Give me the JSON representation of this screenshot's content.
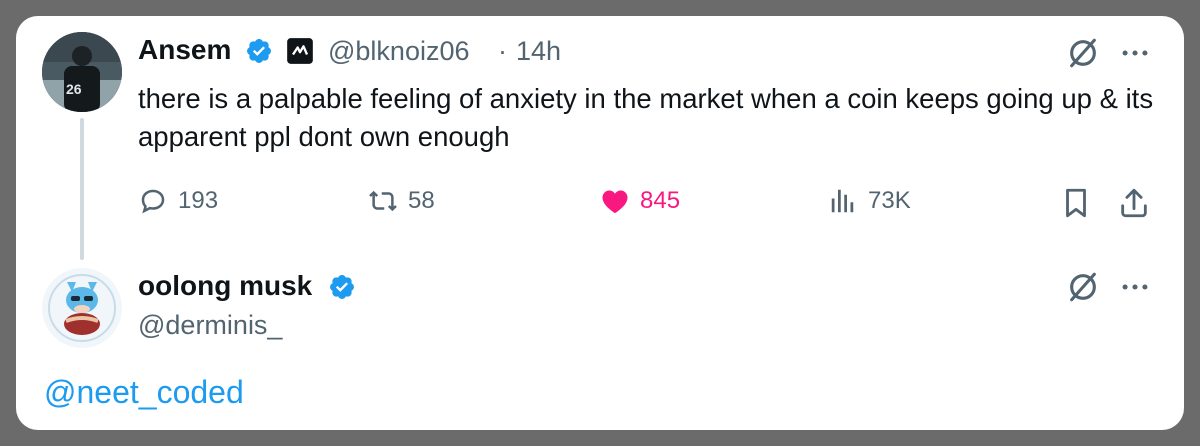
{
  "post": {
    "author_name": "Ansem",
    "author_handle": "@blknoiz06",
    "separator": "·",
    "time": "14h",
    "text": "there is a palpable feeling of anxiety in the market when a coin keeps going up & its apparent ppl dont own enough",
    "avatar_jersey": "26",
    "stats": {
      "replies": "193",
      "reposts": "58",
      "likes": "845",
      "views": "73K"
    },
    "like_color": "#f91880"
  },
  "reply": {
    "author_name": "oolong musk",
    "author_handle": "@derminis_",
    "mention": "@neet_coded"
  },
  "colors": {
    "verified": "#1d9bf0",
    "link": "#1d9bf0",
    "muted": "#536471"
  },
  "icons": [
    "verified-badge-icon",
    "affiliate-badge-icon",
    "grok-icon",
    "more-icon",
    "reply-icon",
    "repost-icon",
    "like-icon",
    "views-icon",
    "bookmark-icon",
    "share-icon"
  ]
}
